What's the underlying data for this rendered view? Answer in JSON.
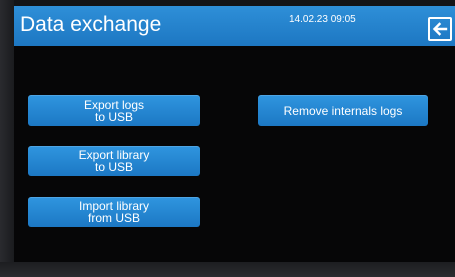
{
  "header": {
    "title": "Data exchange",
    "datetime": "14.02.23 09:05",
    "back_icon": "arrow-left-icon"
  },
  "buttons": {
    "export_logs": [
      "Export logs",
      "to USB"
    ],
    "export_library": [
      "Export library",
      "to USB"
    ],
    "import_library": [
      "Import library",
      "from USB"
    ],
    "remove_logs": [
      "Remove internals logs"
    ]
  },
  "colors": {
    "accent": "#1f7fcb",
    "screen_background": "#060607",
    "text": "#ffffff"
  }
}
